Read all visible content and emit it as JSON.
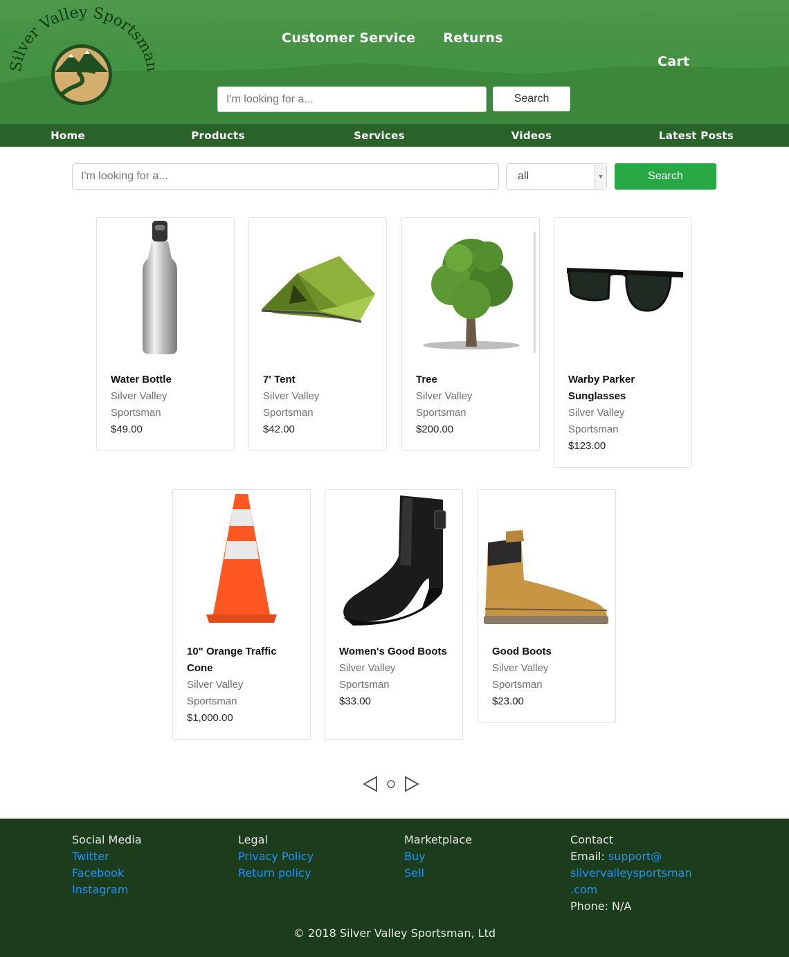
{
  "brand": {
    "name": "Silver Valley Sportsman"
  },
  "header": {
    "links": [
      "Customer Service",
      "Returns"
    ],
    "cart_label": "Cart",
    "search_placeholder": "I'm looking for a...",
    "search_button": "Search"
  },
  "nav": {
    "items": [
      "Home",
      "Products",
      "Services",
      "Videos",
      "Latest Posts"
    ]
  },
  "filter": {
    "search_placeholder": "I'm looking for a...",
    "category_selected": "all",
    "search_button": "Search"
  },
  "products": [
    {
      "name": "Water Bottle",
      "seller": "Silver Valley Sportsman",
      "price": "$49.00",
      "image_icon": "water-bottle"
    },
    {
      "name": "7' Tent",
      "seller": "Silver Valley Sportsman",
      "price": "$42.00",
      "image_icon": "tent"
    },
    {
      "name": "Tree",
      "seller": "Silver Valley Sportsman",
      "price": "$200.00",
      "image_icon": "tree"
    },
    {
      "name": "Warby Parker Sunglasses",
      "seller": "Silver Valley Sportsman",
      "price": "$123.00",
      "image_icon": "sunglasses"
    },
    {
      "name": "10\" Orange Traffic Cone",
      "seller": "Silver Valley Sportsman",
      "price": "$1,000.00",
      "image_icon": "traffic-cone"
    },
    {
      "name": "Women's Good Boots",
      "seller": "Silver Valley Sportsman",
      "price": "$33.00",
      "image_icon": "black-boot"
    },
    {
      "name": "Good Boots",
      "seller": "Silver Valley Sportsman",
      "price": "$23.00",
      "image_icon": "tan-boot"
    }
  ],
  "pager": {
    "prev_icon": "triangle-left",
    "page_icon": "circle",
    "next_icon": "triangle-right"
  },
  "footer": {
    "social": {
      "heading": "Social Media",
      "links": [
        "Twitter",
        "Facebook",
        "Instagram"
      ]
    },
    "legal": {
      "heading": "Legal",
      "links": [
        "Privacy Policy",
        "Return policy"
      ]
    },
    "market": {
      "heading": "Marketplace",
      "links": [
        "Buy",
        "Sell"
      ]
    },
    "contact": {
      "heading": "Contact",
      "email_label": "Email:",
      "email_line1": "support@",
      "email_line2": "silvervalleysportsman",
      "email_line3": ".com",
      "phone": "Phone: N/A"
    },
    "copyright": "© 2018 Silver Valley Sportsman, Ltd"
  },
  "colors": {
    "header_green": "#3f8d3f",
    "nav_green": "#2a632a",
    "footer_green": "#1c3d1c",
    "button_green": "#28a745",
    "link_blue": "#1e90ff"
  }
}
